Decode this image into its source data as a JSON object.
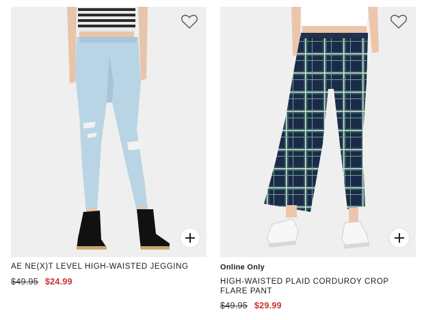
{
  "colors": {
    "sale": "#cf2f2f",
    "text": "#1a1a1a",
    "photo_bg": "#efefef"
  },
  "products": [
    {
      "badge": "",
      "name": "AE NE(X)T LEVEL HIGH-WAISTED JEGGING",
      "original_price": "$49.95",
      "sale_price": "$24.99",
      "favorite_icon": "heart-outline-icon",
      "quick_add_icon": "plus-icon"
    },
    {
      "badge": "Online Only",
      "name": "HIGH-WAISTED PLAID CORDUROY CROP FLARE PANT",
      "original_price": "$49.95",
      "sale_price": "$29.99",
      "favorite_icon": "heart-outline-icon",
      "quick_add_icon": "plus-icon"
    }
  ]
}
